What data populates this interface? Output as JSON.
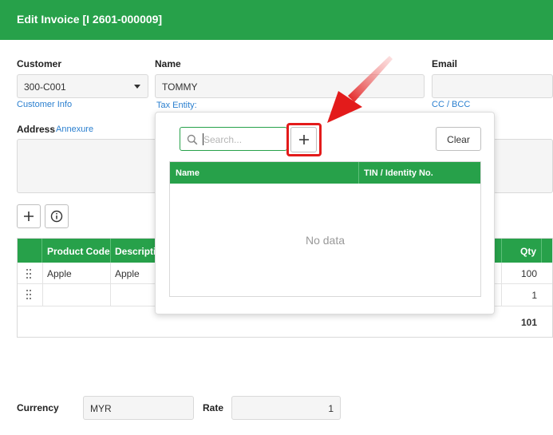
{
  "header": {
    "title": "Edit Invoice [I 2601-000009]",
    "color": "#27a14a"
  },
  "form": {
    "customer_label": "Customer",
    "customer_value": "300-C001",
    "customer_info_link": "Customer Info",
    "name_label": "Name",
    "name_value": "TOMMY",
    "tax_entity_label": "Tax Entity:",
    "email_label": "Email",
    "email_value": "",
    "cc_bcc_link": "CC / BCC",
    "address_label": "Address",
    "annexure_link": "Annexure"
  },
  "table": {
    "columns": [
      "Product Code",
      "Description",
      "Qty"
    ],
    "rows": [
      {
        "product_code": "Apple",
        "description": "Apple",
        "qty": "100"
      },
      {
        "product_code": "",
        "description": "",
        "qty": "1"
      }
    ],
    "total_qty": "101"
  },
  "popup": {
    "search_placeholder": "Search...",
    "clear_label": "Clear",
    "columns": [
      "Name",
      "TIN / Identity No."
    ],
    "empty_text": "No data"
  },
  "footer": {
    "currency_label": "Currency",
    "currency_value": "MYR",
    "rate_label": "Rate",
    "rate_value": "1"
  },
  "icons": {
    "select": "chevron-down-icon",
    "add": "plus-icon",
    "info": "info-icon",
    "search": "search-icon",
    "drag": "drag-handle-icon",
    "callout": "red-arrow-icon"
  },
  "colors": {
    "accent": "#27a14a",
    "link": "#2a7fcf",
    "highlight": "#e31b1b"
  }
}
